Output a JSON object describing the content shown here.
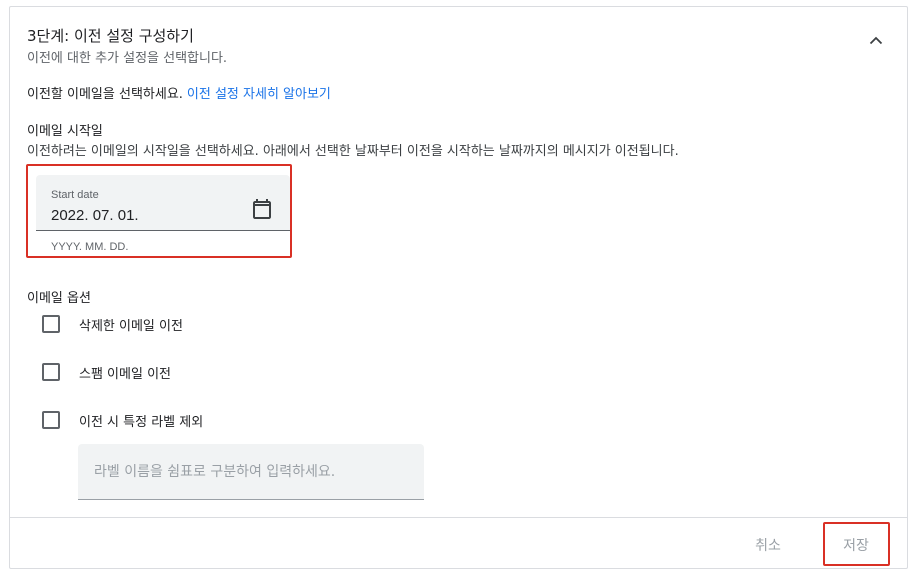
{
  "step": {
    "title": "3단계: 이전 설정 구성하기",
    "subtitle": "이전에 대한 추가 설정을 선택합니다."
  },
  "select_prompt": {
    "text": "이전할 이메일을 선택하세요.",
    "link": "이전 설정 자세히 알아보기"
  },
  "start_section": {
    "title": "이메일 시작일",
    "description": "이전하려는 이메일의 시작일을 선택하세요. 아래에서 선택한 날짜부터 이전을 시작하는 날짜까지의 메시지가 이전됩니다."
  },
  "date_field": {
    "label": "Start date",
    "value": "2022. 07. 01.",
    "hint": "YYYY. MM. DD.",
    "icon": "calendar-icon"
  },
  "options": {
    "title": "이메일 옵션",
    "items": [
      {
        "label": "삭제한 이메일 이전",
        "checked": false
      },
      {
        "label": "스팸 이메일 이전",
        "checked": false
      },
      {
        "label": "이전 시 특정 라벨 제외",
        "checked": false
      }
    ],
    "label_input_placeholder": "라벨 이름을 쉼표로 구분하여 입력하세요."
  },
  "footer": {
    "cancel": "취소",
    "save": "저장"
  },
  "colors": {
    "link": "#1a73e8",
    "highlight": "#d93025",
    "disabled_text": "#9aa0a6"
  }
}
